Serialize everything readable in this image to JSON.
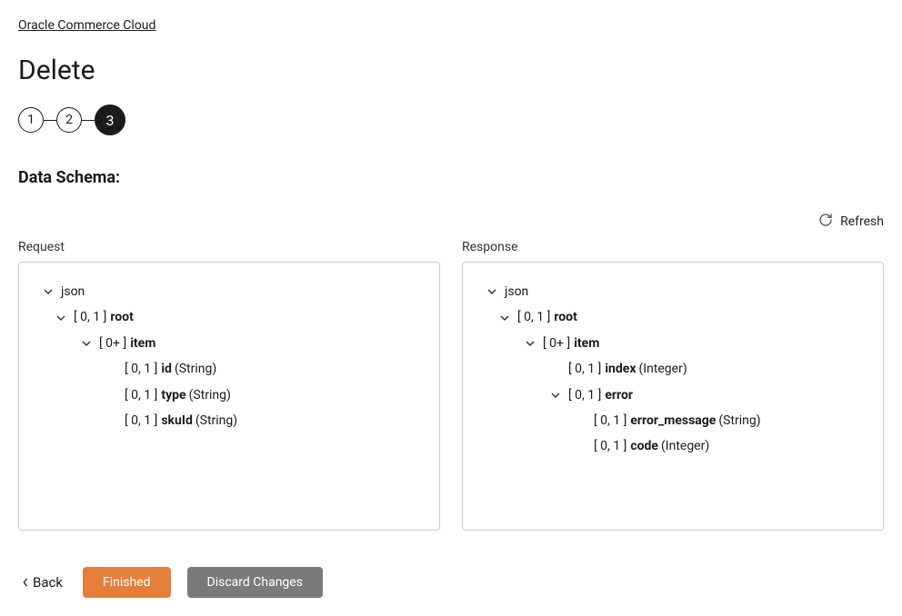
{
  "breadcrumb": {
    "label": "Oracle Commerce Cloud"
  },
  "page": {
    "title": "Delete",
    "section_title": "Data Schema:"
  },
  "stepper": {
    "steps": [
      "1",
      "2",
      "3"
    ],
    "active_index": 2
  },
  "refresh": {
    "label": "Refresh"
  },
  "schema": {
    "request": {
      "col_label": "Request",
      "root_label": "json",
      "tree": {
        "bracket": "[ 0, 1 ]",
        "name": "root",
        "children": {
          "bracket": "[ 0+ ]",
          "name": "item",
          "leaves": [
            {
              "bracket": "[ 0, 1 ]",
              "name": "id",
              "type": "(String)"
            },
            {
              "bracket": "[ 0, 1 ]",
              "name": "type",
              "type": "(String)"
            },
            {
              "bracket": "[ 0, 1 ]",
              "name": "skuId",
              "type": "(String)"
            }
          ]
        }
      }
    },
    "response": {
      "col_label": "Response",
      "root_label": "json",
      "tree": {
        "bracket": "[ 0, 1 ]",
        "name": "root",
        "children": {
          "bracket": "[ 0+ ]",
          "name": "item",
          "leaves": [
            {
              "bracket": "[ 0, 1 ]",
              "name": "index",
              "type": "(Integer)"
            }
          ],
          "sub": {
            "bracket": "[ 0, 1 ]",
            "name": "error",
            "leaves": [
              {
                "bracket": "[ 0, 1 ]",
                "name": "error_message",
                "type": "(String)"
              },
              {
                "bracket": "[ 0, 1 ]",
                "name": "code",
                "type": "(Integer)"
              }
            ]
          }
        }
      }
    }
  },
  "footer": {
    "back": "Back",
    "finished": "Finished",
    "discard": "Discard Changes"
  }
}
